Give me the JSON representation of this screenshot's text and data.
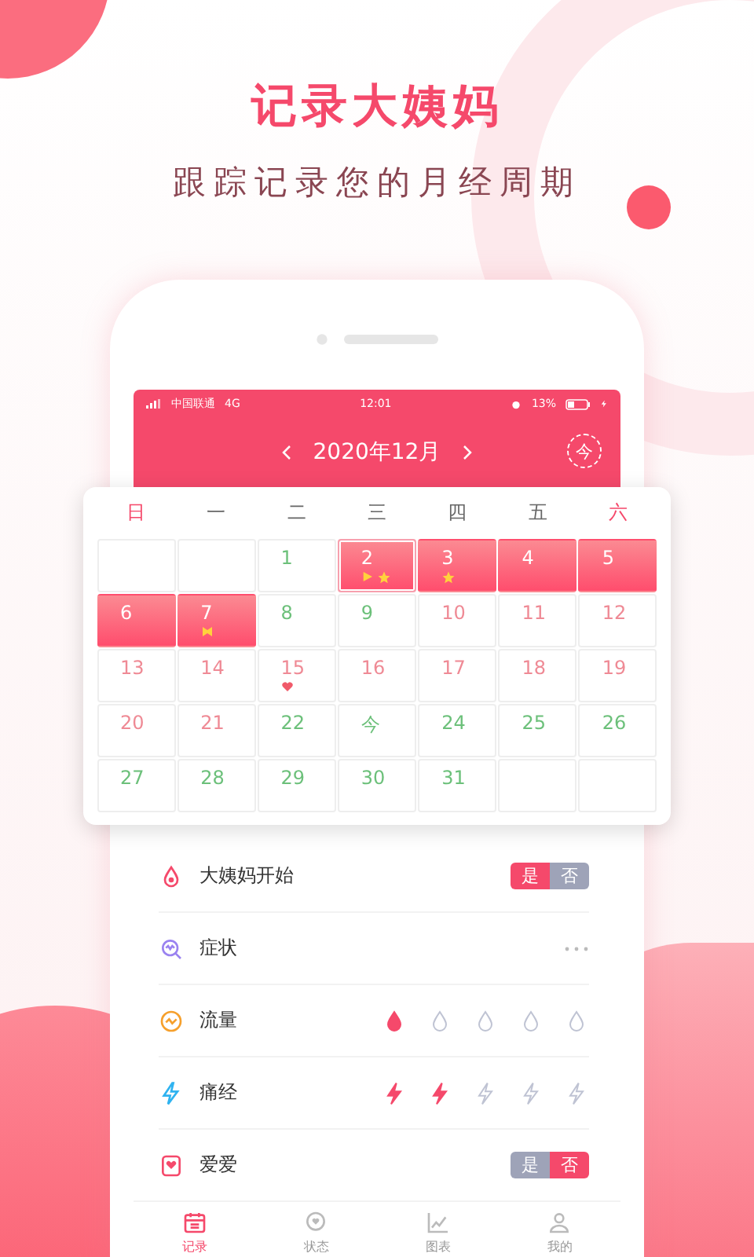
{
  "headline": "记录大姨妈",
  "subtitle": "跟踪记录您的月经周期",
  "status_bar": {
    "carrier": "中国联通",
    "network": "4G",
    "time": "12:01",
    "battery": "13%"
  },
  "header": {
    "month": "2020年12月",
    "today_button": "今"
  },
  "weekdays": [
    {
      "label": "日",
      "weekend": true
    },
    {
      "label": "一",
      "weekend": false
    },
    {
      "label": "二",
      "weekend": false
    },
    {
      "label": "三",
      "weekend": false
    },
    {
      "label": "四",
      "weekend": false
    },
    {
      "label": "五",
      "weekend": false
    },
    {
      "label": "六",
      "weekend": true
    }
  ],
  "days": [
    {
      "kind": "blank",
      "selected": false
    },
    {
      "kind": "blank",
      "selected": false
    },
    {
      "day": "1",
      "kind": "safe",
      "selected": false
    },
    {
      "day": "2",
      "kind": "period",
      "selected": true,
      "marks": [
        {
          "kind": "start"
        },
        {
          "kind": "star"
        }
      ]
    },
    {
      "day": "3",
      "kind": "period",
      "selected": false,
      "marks": [
        {
          "kind": "star"
        }
      ]
    },
    {
      "day": "4",
      "kind": "period",
      "selected": false
    },
    {
      "day": "5",
      "kind": "period",
      "selected": false
    },
    {
      "day": "6",
      "kind": "period",
      "selected": false
    },
    {
      "day": "7",
      "kind": "period",
      "selected": false,
      "marks": [
        {
          "kind": "end"
        }
      ]
    },
    {
      "day": "8",
      "kind": "safe",
      "selected": false
    },
    {
      "day": "9",
      "kind": "safe",
      "selected": false
    },
    {
      "day": "10",
      "kind": "fertile",
      "selected": false
    },
    {
      "day": "11",
      "kind": "fertile",
      "selected": false
    },
    {
      "day": "12",
      "kind": "fertile",
      "selected": false
    },
    {
      "day": "13",
      "kind": "fertile",
      "selected": false
    },
    {
      "day": "14",
      "kind": "fertile",
      "selected": false
    },
    {
      "day": "15",
      "kind": "fertile",
      "selected": false,
      "marks": [
        {
          "kind": "love"
        }
      ]
    },
    {
      "day": "16",
      "kind": "fertile",
      "selected": false
    },
    {
      "day": "17",
      "kind": "fertile",
      "selected": false
    },
    {
      "day": "18",
      "kind": "fertile",
      "selected": false
    },
    {
      "day": "19",
      "kind": "fertile",
      "selected": false
    },
    {
      "day": "20",
      "kind": "fertile",
      "selected": false
    },
    {
      "day": "21",
      "kind": "fertile",
      "selected": false
    },
    {
      "day": "22",
      "kind": "safe",
      "selected": false
    },
    {
      "day": "今",
      "kind": "safe",
      "selected": false
    },
    {
      "day": "24",
      "kind": "safe",
      "selected": false
    },
    {
      "day": "25",
      "kind": "safe",
      "selected": false
    },
    {
      "day": "26",
      "kind": "safe",
      "selected": false
    },
    {
      "day": "27",
      "kind": "safe",
      "selected": false
    },
    {
      "day": "28",
      "kind": "safe",
      "selected": false
    },
    {
      "day": "29",
      "kind": "safe",
      "selected": false
    },
    {
      "day": "30",
      "kind": "safe",
      "selected": false
    },
    {
      "day": "31",
      "kind": "safe",
      "selected": false
    },
    {
      "kind": "blank",
      "selected": false
    },
    {
      "kind": "blank",
      "selected": false
    }
  ],
  "records": [
    {
      "label": "大姨妈开始",
      "kind": "toggle",
      "options": [
        {
          "label": "是",
          "selected": true
        },
        {
          "label": "否",
          "selected": false
        }
      ]
    },
    {
      "label": "症状",
      "kind": "more"
    },
    {
      "label": "流量",
      "kind": "drops",
      "level": 0.2
    },
    {
      "label": "痛经",
      "kind": "bolts",
      "level": 0.4
    },
    {
      "label": "爱爱",
      "kind": "toggle",
      "options": [
        {
          "label": "是",
          "selected": false
        },
        {
          "label": "否",
          "selected": true
        }
      ]
    }
  ],
  "tabs": [
    {
      "label": "记录",
      "selected": true
    },
    {
      "label": "状态",
      "selected": false
    },
    {
      "label": "图表",
      "selected": false
    },
    {
      "label": "我的",
      "selected": false
    }
  ]
}
